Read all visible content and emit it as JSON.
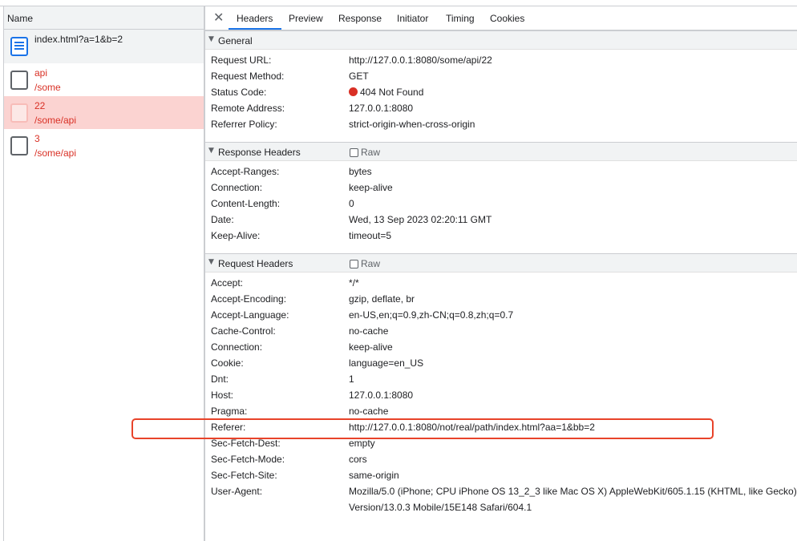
{
  "left_panel": {
    "header": "Name",
    "requests": [
      {
        "name": "index.html?a=1&b=2",
        "path": ""
      },
      {
        "name": "api",
        "path": "/some"
      },
      {
        "name": "22",
        "path": "/some/api"
      },
      {
        "name": "3",
        "path": "/some/api"
      }
    ]
  },
  "tabs": [
    "Headers",
    "Preview",
    "Response",
    "Initiator",
    "Timing",
    "Cookies"
  ],
  "close_symbol": "✕",
  "sections": {
    "general": {
      "title": "General",
      "rows": [
        {
          "key": "Request URL:",
          "value": "http://127.0.0.1:8080/some/api/22"
        },
        {
          "key": "Request Method:",
          "value": "GET"
        },
        {
          "key": "Status Code:",
          "value": "404 Not Found"
        },
        {
          "key": "Remote Address:",
          "value": "127.0.0.1:8080"
        },
        {
          "key": "Referrer Policy:",
          "value": "strict-origin-when-cross-origin"
        }
      ]
    },
    "response": {
      "title": "Response Headers",
      "raw_label": "Raw",
      "rows": [
        {
          "key": "Accept-Ranges:",
          "value": "bytes"
        },
        {
          "key": "Connection:",
          "value": "keep-alive"
        },
        {
          "key": "Content-Length:",
          "value": "0"
        },
        {
          "key": "Date:",
          "value": "Wed, 13 Sep 2023 02:20:11 GMT"
        },
        {
          "key": "Keep-Alive:",
          "value": "timeout=5"
        }
      ]
    },
    "request": {
      "title": "Request Headers",
      "raw_label": "Raw",
      "rows": [
        {
          "key": "Accept:",
          "value": "*/*"
        },
        {
          "key": "Accept-Encoding:",
          "value": "gzip, deflate, br"
        },
        {
          "key": "Accept-Language:",
          "value": "en-US,en;q=0.9,zh-CN;q=0.8,zh;q=0.7"
        },
        {
          "key": "Cache-Control:",
          "value": "no-cache"
        },
        {
          "key": "Connection:",
          "value": "keep-alive"
        },
        {
          "key": "Cookie:",
          "value": "language=en_US"
        },
        {
          "key": "Dnt:",
          "value": "1"
        },
        {
          "key": "Host:",
          "value": "127.0.0.1:8080"
        },
        {
          "key": "Pragma:",
          "value": "no-cache"
        },
        {
          "key": "Referer:",
          "value": "http://127.0.0.1:8080/not/real/path/index.html?aa=1&bb=2"
        },
        {
          "key": "Sec-Fetch-Dest:",
          "value": "empty"
        },
        {
          "key": "Sec-Fetch-Mode:",
          "value": "cors"
        },
        {
          "key": "Sec-Fetch-Site:",
          "value": "same-origin"
        },
        {
          "key": "User-Agent:",
          "value": "Mozilla/5.0 (iPhone; CPU iPhone OS 13_2_3 like Mac OS X) AppleWebKit/605.1.15 (KHTML, like Gecko)"
        },
        {
          "key": "",
          "value": "Version/13.0.3 Mobile/15E148 Safari/604.1"
        }
      ]
    }
  },
  "colors": {
    "error": "#d93025",
    "selected_row": "#fbd3d1",
    "accent": "#1a73e8",
    "highlight_box": "#e8432a"
  }
}
